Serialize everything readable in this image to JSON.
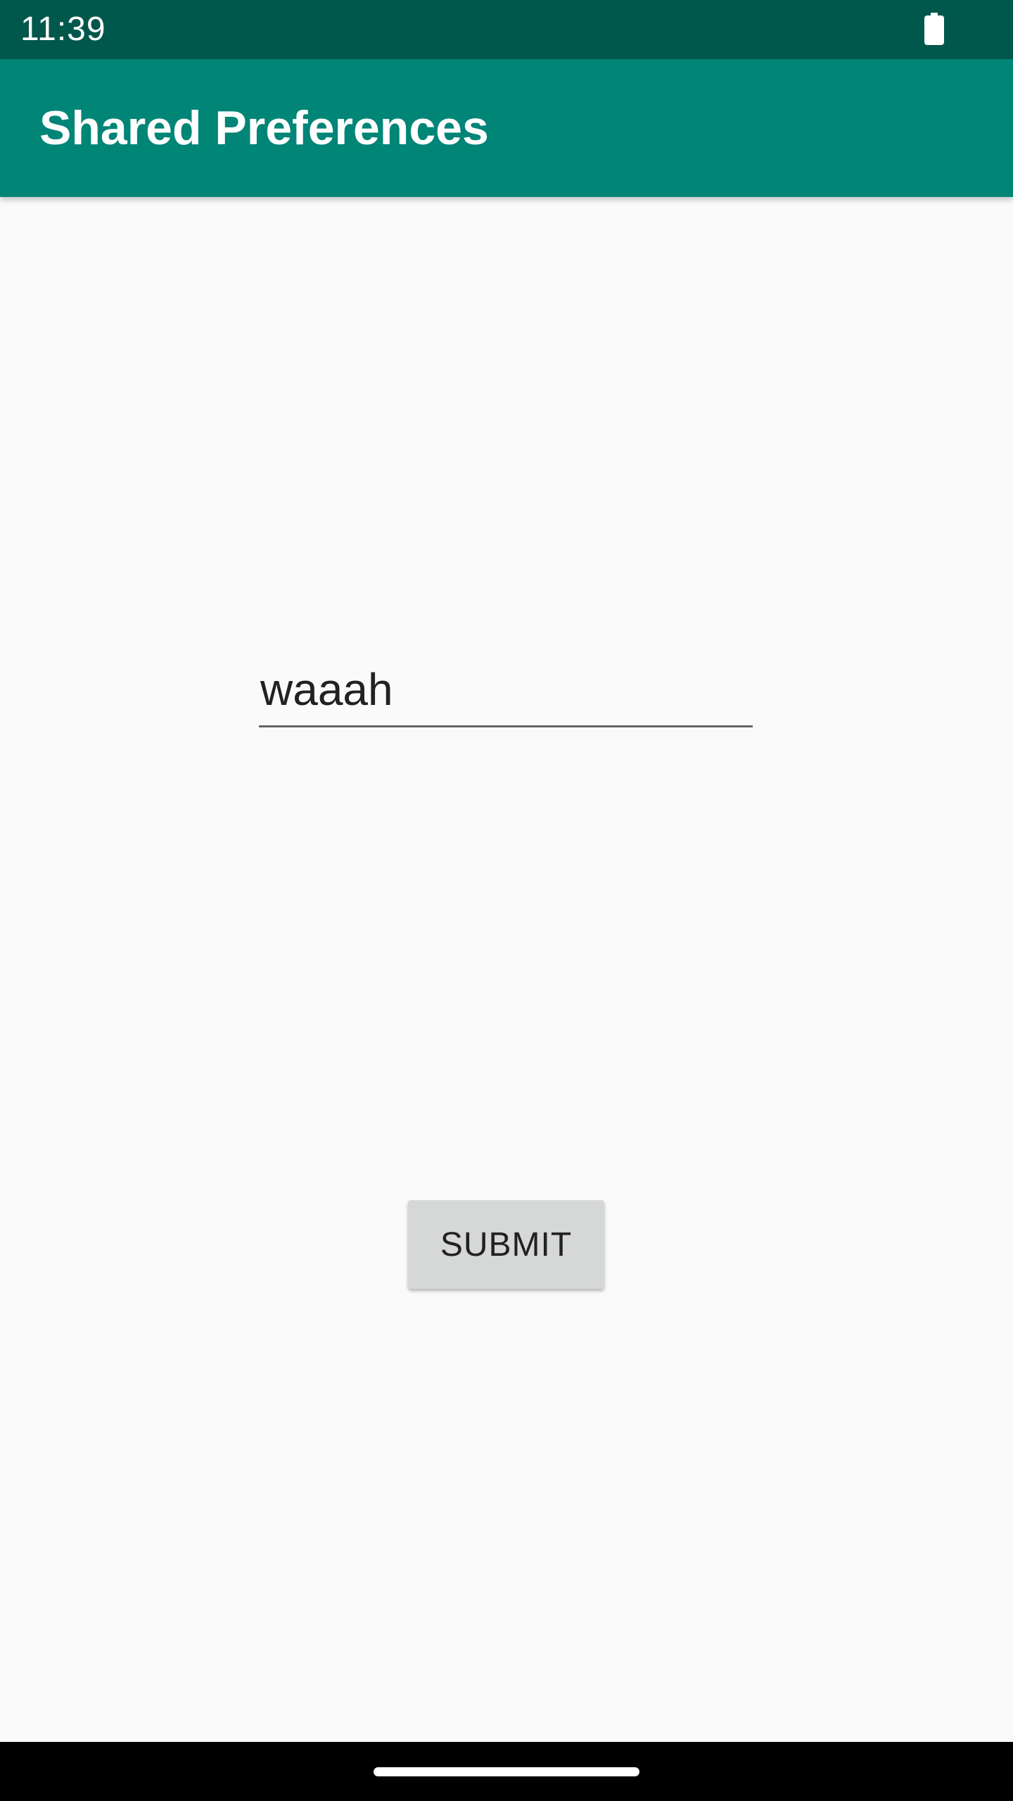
{
  "status_bar": {
    "time": "11:39",
    "battery_icon": "battery-full-icon"
  },
  "app_bar": {
    "title": "Shared Preferences",
    "color": "#008577"
  },
  "form": {
    "input_value": "waaah",
    "submit_label": "SUBMIT"
  },
  "nav_bar": {
    "handle_icon": "gesture-handle"
  }
}
